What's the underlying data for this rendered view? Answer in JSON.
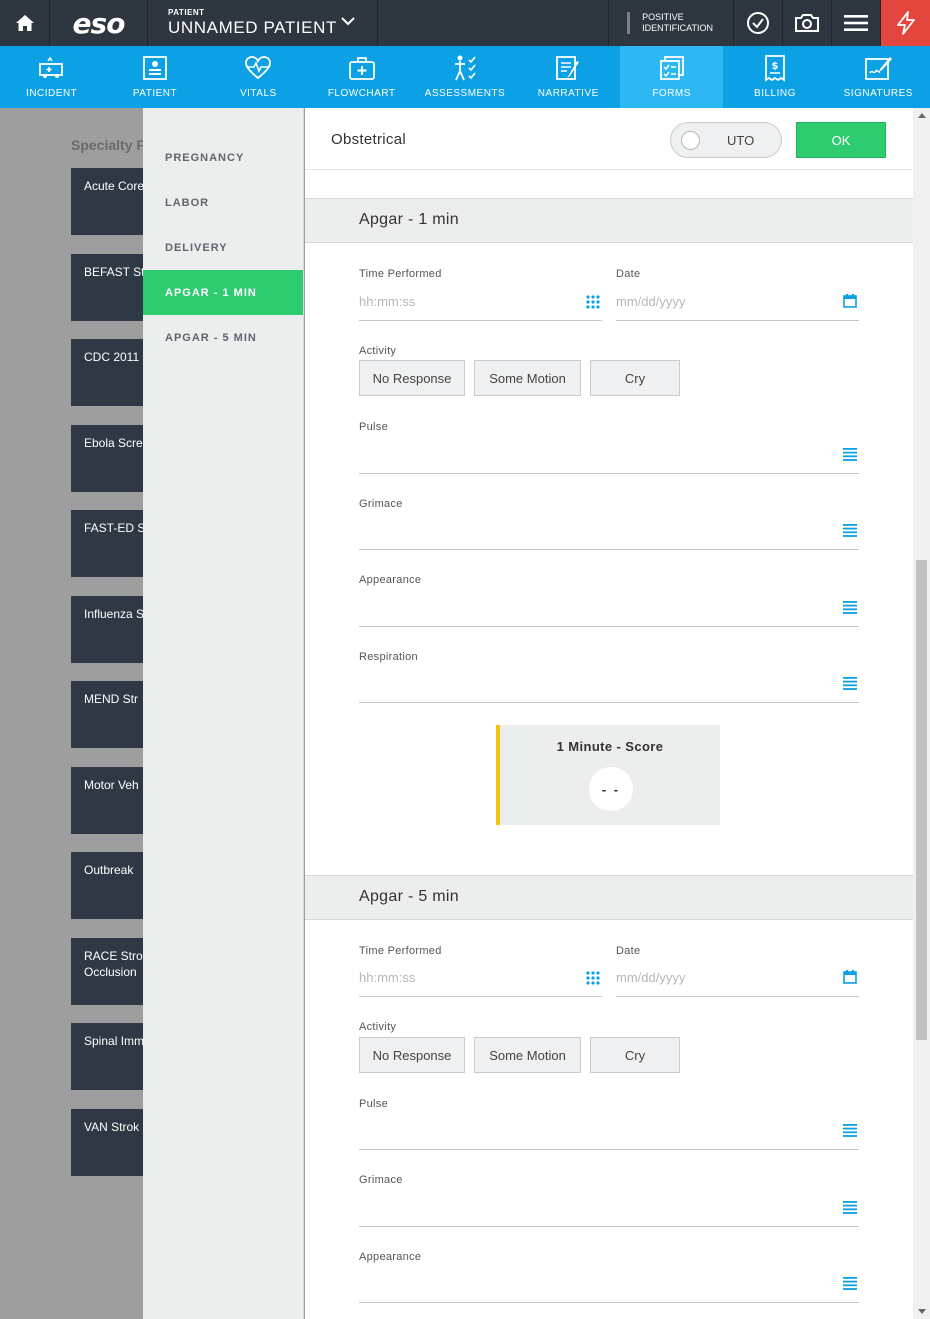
{
  "topbar": {
    "logo": "eso",
    "patient_label": "PATIENT",
    "patient_name": "UNNAMED PATIENT",
    "positive_id": "POSITIVE IDENTIFICATION",
    "icons": [
      "home-icon",
      "chevron-down-icon",
      "checkmark-icon",
      "camera-icon",
      "menu-icon",
      "lightning-icon"
    ],
    "alert_color": "#e4463e"
  },
  "nav": {
    "items": [
      {
        "label": "INCIDENT",
        "icon": "ambulance-icon"
      },
      {
        "label": "PATIENT",
        "icon": "patient-card-icon"
      },
      {
        "label": "VITALS",
        "icon": "heart-pulse-icon"
      },
      {
        "label": "FLOWCHART",
        "icon": "medkit-icon"
      },
      {
        "label": "ASSESSMENTS",
        "icon": "body-checklist-icon"
      },
      {
        "label": "NARRATIVE",
        "icon": "notepad-icon"
      },
      {
        "label": "FORMS",
        "icon": "forms-icon"
      },
      {
        "label": "BILLING",
        "icon": "billing-icon"
      },
      {
        "label": "SIGNATURES",
        "icon": "signature-icon"
      }
    ],
    "active": "FORMS",
    "color": "#0ca0e4"
  },
  "background": {
    "title": "Specialty F",
    "cards": [
      "Acute Core",
      "BEFAST St",
      "CDC 2011",
      "Ebola Scre",
      "FAST-ED S",
      "Influenza S",
      "MEND Str",
      "Motor Veh",
      "Outbreak",
      "RACE Stro\nOcclusion",
      "Spinal Imm",
      "VAN Strok"
    ]
  },
  "sidebar": {
    "items": [
      "PREGNANCY",
      "LABOR",
      "DELIVERY",
      "APGAR - 1 MIN",
      "APGAR - 5 MIN"
    ],
    "active": "APGAR - 1 MIN",
    "active_color": "#2ecc71"
  },
  "form": {
    "title": "Obstetrical",
    "uto_label": "UTO",
    "ok_label": "OK",
    "sections": [
      {
        "title": "Apgar - 1 min",
        "time_label": "Time Performed",
        "time_placeholder": "hh:mm:ss",
        "date_label": "Date",
        "date_placeholder": "mm/dd/yyyy",
        "activity_label": "Activity",
        "activity_options": [
          "No Response",
          "Some Motion",
          "Cry"
        ],
        "pulse_label": "Pulse",
        "grimace_label": "Grimace",
        "appearance_label": "Appearance",
        "respiration_label": "Respiration",
        "score_label": "1 Minute - Score",
        "score_value": "- -"
      },
      {
        "title": "Apgar - 5 min",
        "time_label": "Time Performed",
        "time_placeholder": "hh:mm:ss",
        "date_label": "Date",
        "date_placeholder": "mm/dd/yyyy",
        "activity_label": "Activity",
        "activity_options": [
          "No Response",
          "Some Motion",
          "Cry"
        ],
        "pulse_label": "Pulse",
        "grimace_label": "Grimace",
        "appearance_label": "Appearance"
      }
    ]
  }
}
